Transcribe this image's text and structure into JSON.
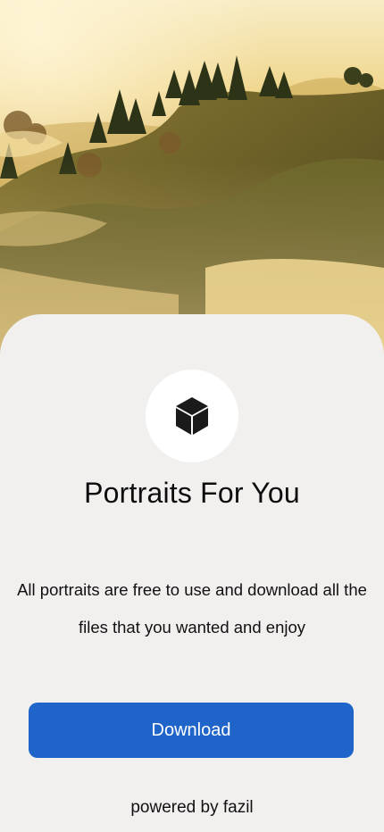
{
  "hero": {
    "image": "misty-hills-landscape"
  },
  "card": {
    "logo_icon": "cube-icon",
    "title": "Portraits For You",
    "description": "All portraits are free to use and download all the files that you wanted and enjoy",
    "download_label": "Download",
    "powered_by": "powered by fazil"
  },
  "colors": {
    "background": "#f2efef",
    "button": "#1f65c9",
    "button_text": "#ffffff",
    "logo_circle": "#ffffff",
    "icon": "#1a1a1a"
  }
}
